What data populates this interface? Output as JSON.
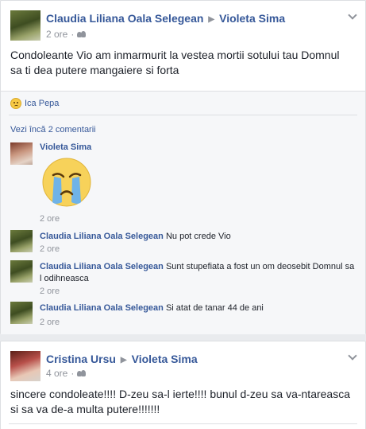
{
  "post1": {
    "author": "Claudia Liliana Oala Selegean",
    "target": "Violeta Sima",
    "time": "2 ore",
    "text": "Condoleante Vio am inmarmurit la vestea mortii sotului tau Domnul sa ti dea putere mangaiere si forta",
    "reaction_name": "Ica Pepa",
    "view_more": "Vezi încă 2 comentarii",
    "comments": [
      {
        "author": "Violeta Sima",
        "text": "",
        "time": "2 ore"
      },
      {
        "author": "Claudia Liliana Oala Selegean",
        "text": "Nu pot crede Vio",
        "time": "2 ore"
      },
      {
        "author": "Claudia Liliana Oala Selegean",
        "text": "Sunt stupefiata a fost un om deosebit Domnul sa l odihneasca",
        "time": "2 ore"
      },
      {
        "author": "Claudia Liliana Oala Selegean",
        "text": "Si atat de tanar 44 de ani",
        "time": "2 ore"
      }
    ]
  },
  "post2": {
    "author": "Cristina Ursu",
    "target": "Violeta Sima",
    "time": "4 ore",
    "text": "sincere condoleate!!!! D-zeu sa-l ierte!!!! bunul d-zeu sa va-ntareasca si sa va de-a multa putere!!!!!!!"
  },
  "colors": {
    "link": "#365899",
    "meta": "#90949c",
    "background": "#e9ebee"
  },
  "icons": [
    "chevron-down-icon",
    "audience-friends-icon",
    "sad-reaction-icon",
    "crying-sticker"
  ]
}
